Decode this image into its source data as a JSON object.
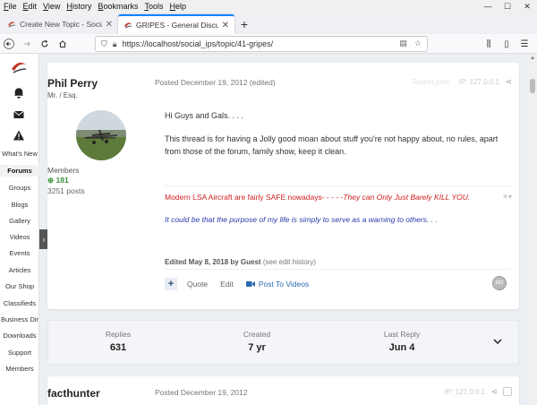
{
  "menubar": {
    "items": [
      "File",
      "Edit",
      "View",
      "History",
      "Bookmarks",
      "Tools",
      "Help"
    ]
  },
  "window_controls": {
    "minimize": "—",
    "maximize": "☐",
    "close": "✕"
  },
  "tabs": [
    {
      "title": "Create New Topic - Social Austr",
      "close": "✕"
    },
    {
      "title": "GRIPES - General Discussion - S",
      "close": "✕"
    }
  ],
  "newtab": "+",
  "urlbar": {
    "url": "https://localhost/social_ips/topic/41-gripes/"
  },
  "sidebar": {
    "items": [
      "What's New",
      "Forums",
      "Groups",
      "Blogs",
      "Gallery",
      "Videos",
      "Events",
      "Articles",
      "Our Shop",
      "Classifieds",
      "Business Dir",
      "Downloads",
      "Support",
      "Members"
    ],
    "toggle": "›"
  },
  "post1": {
    "author": "Phil Perry",
    "title": "Mr. / Esq.",
    "group": "Members",
    "reputation": "181",
    "posts": "3251 posts",
    "meta": "Posted December 19, 2012 (edited)",
    "faint_text": "Report post",
    "ip": "IP: 127.0.0.1",
    "body": [
      "Hi Guys and Gals. . . .",
      "This thread is for having a Jolly good moan about stuff you're not happy about, no rules, apart",
      "from those of the forum, family show, keep it clean."
    ],
    "signature": {
      "part1": "Modern LSA Aircraft are fairly SAFE nowadays- - - - -",
      "part2": "They can Only Just Barely KILL YOU.",
      "line2": "It could be that the purpose of my life is simply to serve as a warning to others. . ."
    },
    "edited": {
      "prefix": "Edited May 8, 2018 by Guest",
      "link": "(see edit history)"
    },
    "actions": {
      "plus": "+",
      "quote": "Quote",
      "edit": "Edit",
      "video": "Post To Videos"
    },
    "reaction": "NO"
  },
  "stats": {
    "replies_label": "Replies",
    "replies_value": "631",
    "created_label": "Created",
    "created_value": "7 yr",
    "last_label": "Last Reply",
    "last_value": "Jun 4"
  },
  "post2": {
    "author": "facthunter",
    "meta": "Posted December 19, 2012",
    "ip": "IP: 127.0.0.1"
  },
  "colors": {
    "accent": "#0a84ff",
    "link": "#2a6ab0",
    "signature_red": "#d02020",
    "signature_blue": "#2a3aa8",
    "reputation_green": "#3a8f3a"
  }
}
